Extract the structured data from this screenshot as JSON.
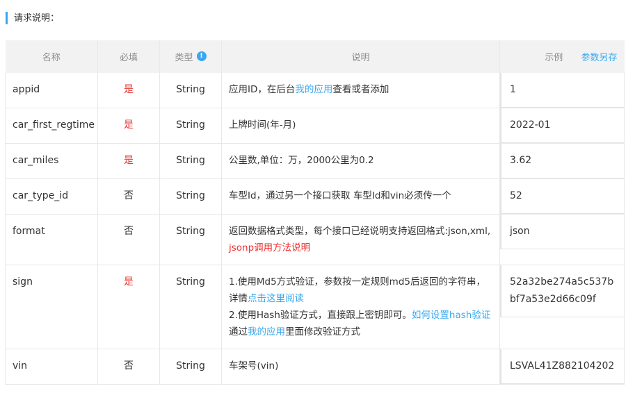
{
  "section": {
    "title": "请求说明："
  },
  "table": {
    "headers": {
      "name": "名称",
      "required": "必填",
      "type": "类型",
      "info_icon": "!",
      "description": "说明",
      "example": "示例",
      "save_as": "参数另存"
    },
    "rows": [
      {
        "name": "appid",
        "required": "是",
        "type": "String",
        "desc_before": "应用ID，在后台",
        "desc_link": "我的应用",
        "desc_after": "查看或者添加",
        "example": "1"
      },
      {
        "name": "car_first_regtime",
        "required": "是",
        "type": "String",
        "desc": "上牌时间(年-月)",
        "example": "2022-01"
      },
      {
        "name": "car_miles",
        "required": "是",
        "type": "String",
        "desc": "公里数,单位：万，2000公里为0.2",
        "example": "3.62"
      },
      {
        "name": "car_type_id",
        "required": "否",
        "type": "String",
        "desc": "车型Id，通过另一个接口获取 车型Id和vin必须传一个",
        "example": "52"
      },
      {
        "name": "format",
        "required": "否",
        "type": "String",
        "desc_before": "返回数据格式类型，每个接口已经说明支持返回格式:json,xml, ",
        "desc_link": "jsonp调用方法说明",
        "example": "json"
      },
      {
        "name": "sign",
        "required": "是",
        "type": "String",
        "desc_l1_before": "1.使用Md5方式验证，参数按一定规则md5后返回的字符串，详情",
        "desc_l1_link": "点击这里阅读",
        "desc_l2_before": "2.使用Hash验证方式，直接跟上密钥即可。",
        "desc_l2_link": "如何设置hash验证",
        "desc_l3_before": "通过",
        "desc_l3_link": "我的应用",
        "desc_l3_after": "里面修改验证方式",
        "example": "52a32be274a5c537bbf7a53e2d66c09f"
      },
      {
        "name": "vin",
        "required": "否",
        "type": "String",
        "desc": "车架号(vin)",
        "example": "LSVAL41Z882104202"
      }
    ]
  },
  "colors": {
    "accent": "#39a7ee",
    "required": "#e53935",
    "link_red": "#ef2e2e",
    "header_bg": "#f2f2f2"
  }
}
